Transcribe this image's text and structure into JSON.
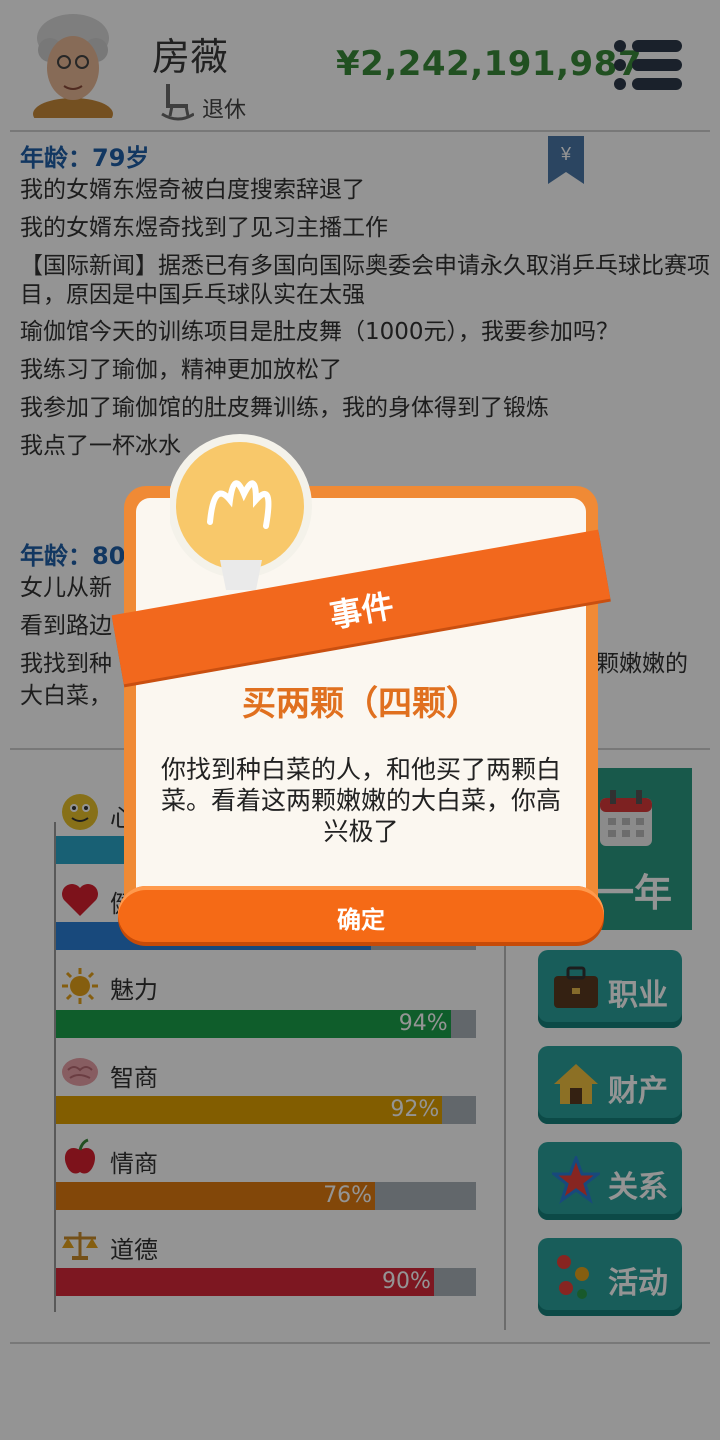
{
  "header": {
    "name": "房薇",
    "status": "退休",
    "money": "¥2,242,191,987"
  },
  "log": {
    "blocks": [
      {
        "age": "年龄：79岁",
        "lines": [
          "我的女婿东煜奇被白度搜索辞退了",
          "我的女婿东煜奇找到了见习主播工作",
          "【国际新闻】据悉已有多国向国际奥委会申请永久取消乒乓球比赛项目，原因是中国乒乓球队实在太强",
          "瑜伽馆今天的训练项目是肚皮舞（1000元），我要参加吗？",
          "我练习了瑜伽，精神更加放松了",
          "我参加了瑜伽馆的肚皮舞训练，我的身体得到了锻炼",
          "我点了一杯冰水"
        ]
      },
      {
        "age": "年龄：80",
        "lines": [
          "女儿从新",
          "看到路边",
          "我找到种",
          "颗嫩嫩的",
          "大白菜，"
        ]
      }
    ]
  },
  "stats": [
    {
      "label": "心",
      "percent": 100,
      "color": "#2aa6c9",
      "icon": "smiley-icon"
    },
    {
      "label": "健",
      "percent": 75,
      "color": "#2a7fd6",
      "icon": "heart-icon"
    },
    {
      "label": "魅力",
      "percent": 94,
      "color": "#1aa14b",
      "percent_text": "94%",
      "icon": "sun-icon"
    },
    {
      "label": "智商",
      "percent": 92,
      "color": "#e0a000",
      "percent_text": "92%",
      "icon": "brain-icon"
    },
    {
      "label": "情商",
      "percent": 76,
      "color": "#e07a10",
      "percent_text": "76%",
      "icon": "apple-icon"
    },
    {
      "label": "道德",
      "percent": 90,
      "color": "#d8283a",
      "percent_text": "90%",
      "icon": "scales-icon"
    }
  ],
  "side_buttons": {
    "next_year": "一年",
    "career": "职业",
    "assets": "财产",
    "relations": "关系",
    "activities": "活动"
  },
  "dialog": {
    "ribbon": "事件",
    "title": "买两颗（四颗）",
    "body": "你找到种白菜的人，和他买了两颗白菜。看着这两颗嫩嫩的大白菜，你高兴极了",
    "ok": "确定"
  }
}
